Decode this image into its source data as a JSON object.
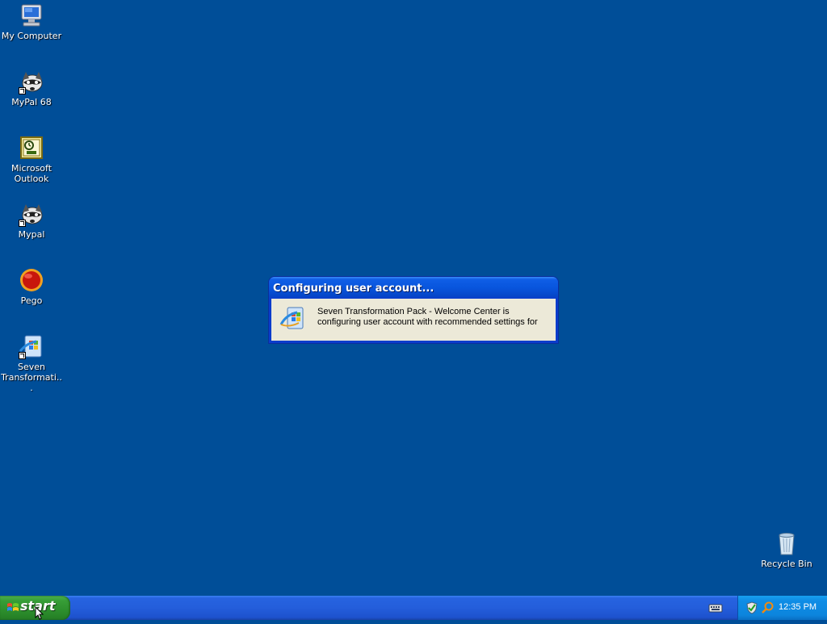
{
  "desktop": {
    "icons": [
      {
        "label": "My Computer",
        "icon": "computer-icon"
      },
      {
        "label": "MyPal 68",
        "icon": "raccoon-icon"
      },
      {
        "label": "Microsoft Outlook",
        "icon": "outlook-icon"
      },
      {
        "label": "Mypal",
        "icon": "raccoon-icon"
      },
      {
        "label": "Pego",
        "icon": "red-orb-icon"
      },
      {
        "label": "Seven Transformati...",
        "icon": "seven-transformation-icon"
      },
      {
        "label": "Recycle Bin",
        "icon": "recycle-bin-icon"
      }
    ]
  },
  "dialog": {
    "title": "Configuring user account...",
    "message": "Seven Transformation Pack - Welcome Center is configuring user account with recommended settings for",
    "icon": "seven-transformation-icon"
  },
  "taskbar": {
    "start_label": "start",
    "clock": "12:35 PM",
    "tray_icons": [
      "security-shield-icon",
      "search-icon"
    ],
    "language_icon": "keyboard-icon"
  },
  "colors": {
    "desktop_bg": "#004e98",
    "taskbar": "#245edb",
    "start_button": "#379e37",
    "title_bar": "#0855dd",
    "dialog_body": "#ece9d8"
  }
}
